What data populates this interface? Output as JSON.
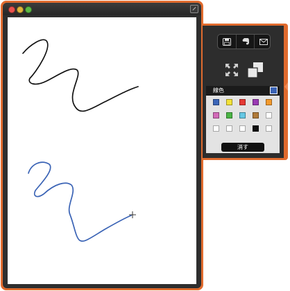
{
  "window": {
    "controls": [
      "close",
      "minimize",
      "zoom"
    ]
  },
  "canvas": {
    "strokes": [
      {
        "color": "#111111",
        "name": "black-stroke"
      },
      {
        "color": "#3a63b5",
        "name": "blue-stroke"
      }
    ]
  },
  "toolbar": {
    "icons": [
      "save-icon",
      "evernote-icon",
      "mail-icon",
      "fullscreen-icon",
      "copy-icon"
    ]
  },
  "color_panel": {
    "label": "線色",
    "current_color": "#3a63b5",
    "palette": [
      [
        "#3b66b8",
        "#f3e23a",
        "#e53a35",
        "#9a3bb4",
        "#f39a2d"
      ],
      [
        "#d26bb8",
        "#4bb545",
        "#66c8e4",
        "#b07a3a",
        "#ffffff"
      ],
      [
        "#ffffff",
        "#ffffff",
        "#ffffff",
        "#111111",
        "#ffffff"
      ]
    ],
    "erase_label": "消す"
  }
}
